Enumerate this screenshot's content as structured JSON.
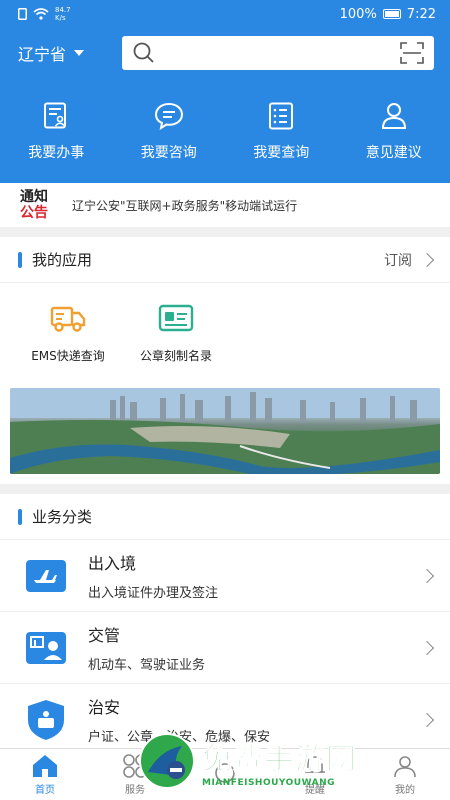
{
  "status_bar": {
    "speed": "84.7",
    "speed_unit": "K/s",
    "battery": "100%",
    "time": "7:22"
  },
  "header": {
    "province": "辽宁省",
    "quick_actions": [
      {
        "label": "我要办事",
        "icon": "document-user-icon"
      },
      {
        "label": "我要咨询",
        "icon": "chat-bubble-icon"
      },
      {
        "label": "我要查询",
        "icon": "list-search-icon"
      },
      {
        "label": "意见建议",
        "icon": "person-icon"
      }
    ]
  },
  "notice": {
    "logo_line1": "通知",
    "logo_line2": "公告",
    "text": "辽宁公安\"互联网+政务服务\"移动端试运行"
  },
  "my_apps": {
    "title": "我的应用",
    "action": "订阅",
    "items": [
      {
        "label": "EMS快递查询",
        "icon": "delivery-truck-icon",
        "color": "#f0a030"
      },
      {
        "label": "公章刻制名录",
        "icon": "id-card-icon",
        "color": "#2bb08f"
      }
    ]
  },
  "business": {
    "title": "业务分类",
    "items": [
      {
        "title": "出入境",
        "subtitle": "出入境证件办理及签注",
        "icon": "airplane-icon"
      },
      {
        "title": "交管",
        "subtitle": "机动车、驾驶证业务",
        "icon": "traffic-id-icon"
      },
      {
        "title": "治安",
        "subtitle": "户证、公章、治安、危爆、保安",
        "icon": "police-badge-icon"
      }
    ]
  },
  "tabbar": {
    "items": [
      {
        "label": "首页",
        "icon": "home-icon",
        "active": true
      },
      {
        "label": "服务",
        "icon": "grid-icon",
        "active": false
      },
      {
        "label": "",
        "icon": "center-icon",
        "active": false
      },
      {
        "label": "提醒",
        "icon": "bell-icon",
        "active": false
      },
      {
        "label": "我的",
        "icon": "user-icon",
        "active": false
      }
    ]
  },
  "watermark": {
    "cn": "免费手游网",
    "en": "MIANFEISHOUYOUWANG"
  },
  "colors": {
    "primary": "#2b88e2",
    "notice_red": "#d8262f",
    "watermark_green": "#2ea84a"
  }
}
